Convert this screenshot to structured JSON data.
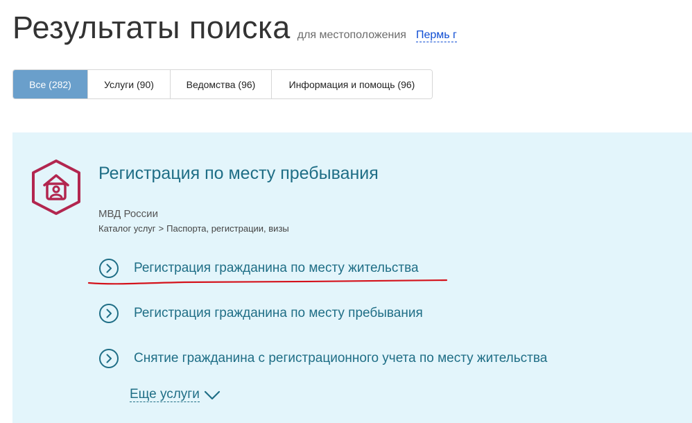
{
  "header": {
    "title": "Результаты поиска",
    "location_caption": "для местоположения",
    "location_value": "Пермь г"
  },
  "tabs": [
    {
      "label": "Все (282)",
      "active": true
    },
    {
      "label": "Услуги (90)",
      "active": false
    },
    {
      "label": "Ведомства (96)",
      "active": false
    },
    {
      "label": "Информация и помощь (96)",
      "active": false
    }
  ],
  "result": {
    "icon": "house-with-person-icon",
    "title": "Регистрация по месту пребывания",
    "department": "МВД России",
    "breadcrumb": [
      "Каталог услуг",
      ">",
      "Паспорта, регистрации, визы"
    ],
    "services": [
      {
        "label": "Регистрация гражданина по месту жительства",
        "icon": "chevron-right-circle-icon",
        "highlighted": true
      },
      {
        "label": "Регистрация гражданина по месту пребывания",
        "icon": "chevron-right-circle-icon",
        "highlighted": false
      },
      {
        "label": "Снятие гражданина с регистрационного учета по месту жительства",
        "icon": "chevron-right-circle-icon",
        "highlighted": false
      }
    ],
    "more_label": "Еще услуги",
    "more_icon": "chevron-down-icon"
  },
  "colors": {
    "accent_tab": "#6a9fcb",
    "card_bg": "#e3f5fb",
    "link_teal": "#1f6e86",
    "icon_crimson": "#b2264f",
    "annotation_red": "#d4121b"
  }
}
